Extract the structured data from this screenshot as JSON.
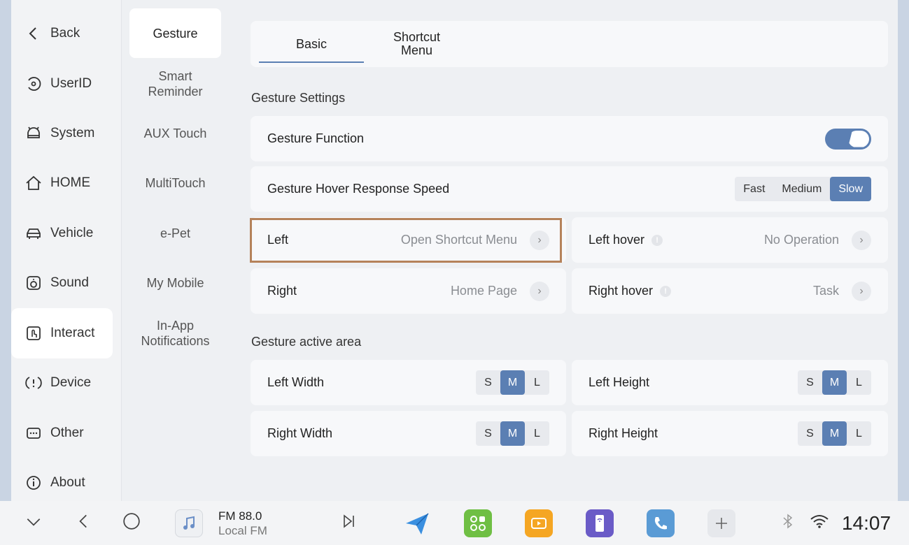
{
  "nav": {
    "back": "Back",
    "items": [
      {
        "label": "UserID",
        "icon": "user-id-icon"
      },
      {
        "label": "System",
        "icon": "system-icon"
      },
      {
        "label": "HOME",
        "icon": "home-icon"
      },
      {
        "label": "Vehicle",
        "icon": "car-icon"
      },
      {
        "label": "Sound",
        "icon": "speaker-icon"
      },
      {
        "label": "Interact",
        "icon": "touch-icon"
      },
      {
        "label": "Device",
        "icon": "device-icon"
      },
      {
        "label": "Other",
        "icon": "more-icon"
      },
      {
        "label": "About",
        "icon": "info-icon"
      }
    ],
    "active": "Interact"
  },
  "subnav": {
    "items": [
      "Gesture",
      "Smart Reminder",
      "AUX Touch",
      "MultiTouch",
      "e-Pet",
      "My Mobile",
      "In-App Notifications"
    ],
    "active": "Gesture"
  },
  "tabs": {
    "basic": "Basic",
    "shortcut": "Shortcut Menu"
  },
  "gesture_settings": {
    "title": "Gesture Settings",
    "function_label": "Gesture Function",
    "function_on": true,
    "speed_label": "Gesture Hover Response Speed",
    "speed_options": [
      "Fast",
      "Medium",
      "Slow"
    ],
    "speed_selected": "Slow",
    "left_label": "Left",
    "left_value": "Open Shortcut Menu",
    "left_hover_label": "Left hover",
    "left_hover_value": "No Operation",
    "right_label": "Right",
    "right_value": "Home Page",
    "right_hover_label": "Right hover",
    "right_hover_value": "Task"
  },
  "active_area": {
    "title": "Gesture active area",
    "left_width": "Left Width",
    "left_height": "Left Height",
    "right_width": "Right Width",
    "right_height": "Right Height",
    "options": [
      "S",
      "M",
      "L"
    ],
    "selected": "M"
  },
  "dock": {
    "fm_title": "FM 88.0",
    "fm_sub": "Local FM",
    "time": "14:07"
  },
  "colors": {
    "accent": "#5b7fb3",
    "highlight": "#b5825a"
  }
}
